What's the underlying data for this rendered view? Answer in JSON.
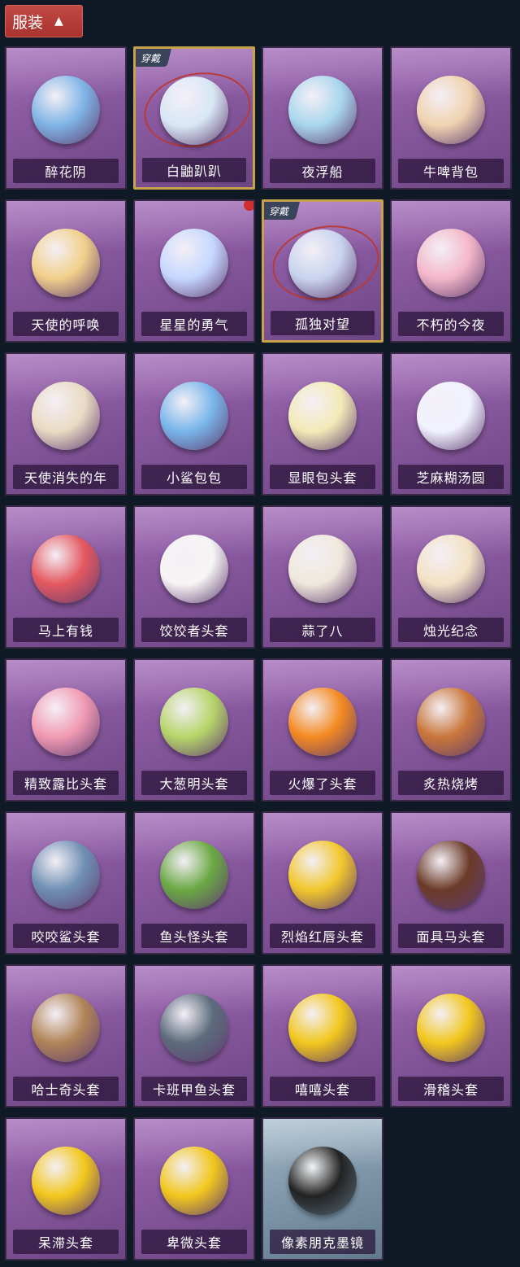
{
  "header": {
    "title": "服装",
    "chevron_icon": "chevron-up-icon"
  },
  "items": [
    {
      "name": "醉花阴",
      "worn": false,
      "color": "#7fb4e6",
      "badge": false,
      "style": "purple"
    },
    {
      "name": "白鼬趴趴",
      "worn": true,
      "color": "#d8e7f5",
      "badge": false,
      "style": "purple"
    },
    {
      "name": "夜浮船",
      "worn": false,
      "color": "#a9d7ee",
      "badge": false,
      "style": "purple"
    },
    {
      "name": "牛啤背包",
      "worn": false,
      "color": "#f0d3b0",
      "badge": false,
      "style": "purple"
    },
    {
      "name": "天使的呼唤",
      "worn": false,
      "color": "#f2d08a",
      "badge": false,
      "style": "purple"
    },
    {
      "name": "星星的勇气",
      "worn": false,
      "color": "#c6d8ff",
      "badge": true,
      "style": "purple"
    },
    {
      "name": "孤独对望",
      "worn": true,
      "color": "#c9d3ee",
      "badge": false,
      "style": "purple"
    },
    {
      "name": "不朽的今夜",
      "worn": false,
      "color": "#f4b7c9",
      "badge": false,
      "style": "purple"
    },
    {
      "name": "天使消失的年",
      "worn": false,
      "color": "#eadbc4",
      "badge": false,
      "style": "purple"
    },
    {
      "name": "小鲨包包",
      "worn": false,
      "color": "#79b6ea",
      "badge": false,
      "style": "purple"
    },
    {
      "name": "显眼包头套",
      "worn": false,
      "color": "#f3eab7",
      "badge": false,
      "style": "purple"
    },
    {
      "name": "芝麻糊汤圆",
      "worn": false,
      "color": "#f0f2ff",
      "badge": false,
      "style": "purple"
    },
    {
      "name": "马上有钱",
      "worn": false,
      "color": "#e45860",
      "badge": false,
      "style": "purple"
    },
    {
      "name": "饺饺者头套",
      "worn": false,
      "color": "#f6f4f4",
      "badge": false,
      "style": "purple"
    },
    {
      "name": "蒜了八",
      "worn": false,
      "color": "#efe8dc",
      "badge": false,
      "style": "purple"
    },
    {
      "name": "烛光纪念",
      "worn": false,
      "color": "#f3e2c5",
      "badge": false,
      "style": "purple"
    },
    {
      "name": "精致露比头套",
      "worn": false,
      "color": "#f29ab3",
      "badge": false,
      "style": "purple"
    },
    {
      "name": "大葱明头套",
      "worn": false,
      "color": "#b7d56a",
      "badge": false,
      "style": "purple"
    },
    {
      "name": "火爆了头套",
      "worn": false,
      "color": "#f48a20",
      "badge": false,
      "style": "purple"
    },
    {
      "name": "炙热烧烤",
      "worn": false,
      "color": "#c9763a",
      "badge": false,
      "style": "purple"
    },
    {
      "name": "咬咬鲨头套",
      "worn": false,
      "color": "#6f8fb3",
      "badge": false,
      "style": "purple"
    },
    {
      "name": "鱼头怪头套",
      "worn": false,
      "color": "#6aa843",
      "badge": false,
      "style": "purple"
    },
    {
      "name": "烈焰红唇头套",
      "worn": false,
      "color": "#f2c72c",
      "badge": false,
      "style": "purple"
    },
    {
      "name": "面具马头套",
      "worn": false,
      "color": "#6b3a28",
      "badge": false,
      "style": "purple"
    },
    {
      "name": "哈士奇头套",
      "worn": false,
      "color": "#b08458",
      "badge": false,
      "style": "purple"
    },
    {
      "name": "卡班甲鱼头套",
      "worn": false,
      "color": "#5c6b7c",
      "badge": false,
      "style": "purple"
    },
    {
      "name": "嘻嘻头套",
      "worn": false,
      "color": "#f2c71d",
      "badge": false,
      "style": "purple"
    },
    {
      "name": "滑稽头套",
      "worn": false,
      "color": "#f2c71d",
      "badge": false,
      "style": "purple"
    },
    {
      "name": "呆滞头套",
      "worn": false,
      "color": "#f2c71d",
      "badge": false,
      "style": "purple"
    },
    {
      "name": "卑微头套",
      "worn": false,
      "color": "#f2c71d",
      "badge": false,
      "style": "purple"
    },
    {
      "name": "像素朋克墨镜",
      "worn": false,
      "color": "#222222",
      "badge": false,
      "style": "grey"
    }
  ],
  "worn_label": "穿戴"
}
